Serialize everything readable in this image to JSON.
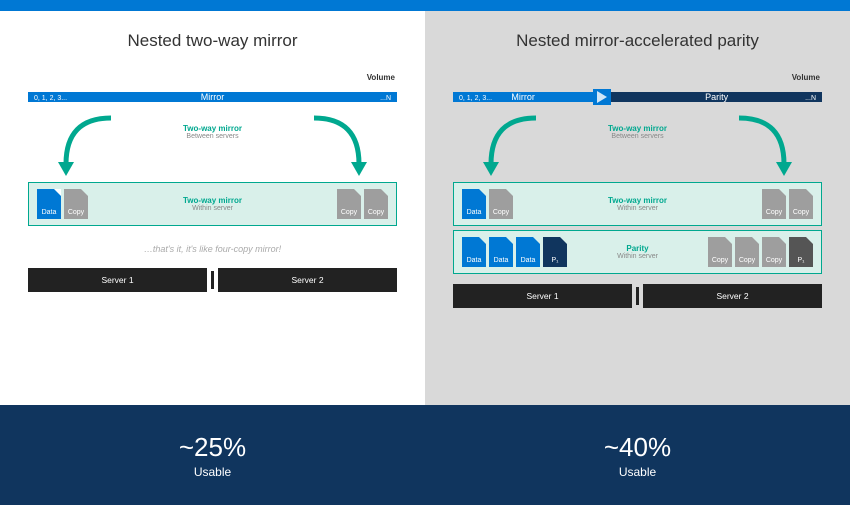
{
  "left": {
    "title": "Nested two-way mirror",
    "volume_label": "Volume",
    "index_text": "0, 1, 2, 3...",
    "end_n": "...N",
    "bar_mirror": "Mirror",
    "arrow_title": "Two-way mirror",
    "arrow_sub": "Between servers",
    "strip_title": "Two-way mirror",
    "strip_sub": "Within server",
    "block_data": "Data",
    "block_copy": "Copy",
    "quote": "…that's it, it's like four-copy mirror!",
    "server1": "Server 1",
    "server2": "Server 2",
    "pct": "~25%",
    "usable": "Usable"
  },
  "right": {
    "title": "Nested mirror-accelerated parity",
    "volume_label": "Volume",
    "index_text": "0, 1, 2, 3...",
    "end_n": "...N",
    "bar_mirror": "Mirror",
    "bar_parity": "Parity",
    "arrow_title": "Two-way mirror",
    "arrow_sub": "Between servers",
    "strip_title": "Two-way mirror",
    "strip_sub": "Within server",
    "parity_title": "Parity",
    "parity_sub": "Within server",
    "block_data": "Data",
    "block_copy": "Copy",
    "block_p": "P₁",
    "server1": "Server 1",
    "server2": "Server 2",
    "pct": "~40%",
    "usable": "Usable"
  },
  "colors": {
    "accent": "#0078d4",
    "teal": "#00a88f",
    "dark_navy": "#10355e",
    "panel_right_bg": "#d9d9d9",
    "server_bg": "#222222"
  }
}
